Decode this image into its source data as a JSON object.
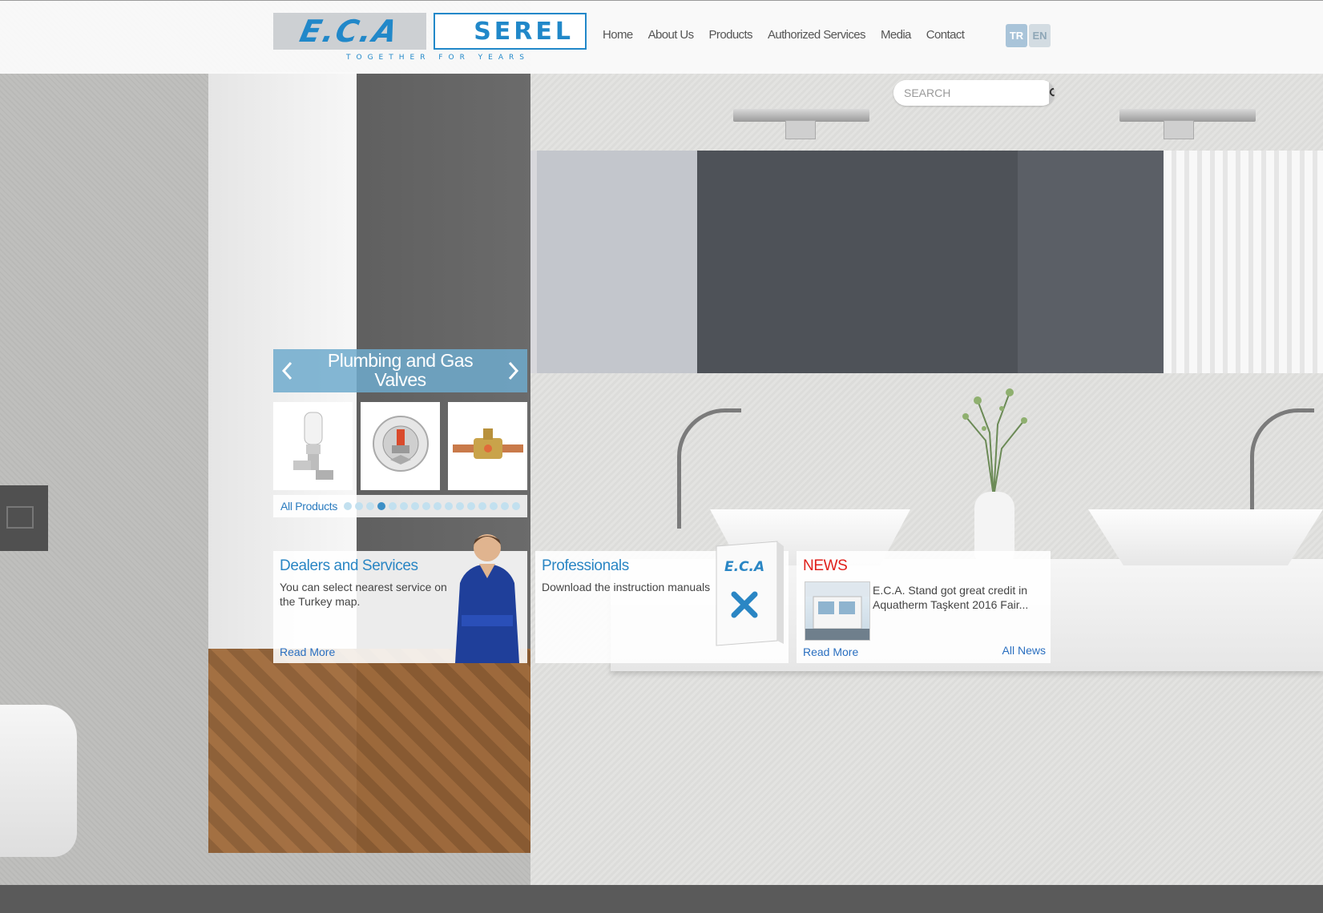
{
  "header": {
    "logo_eca": "E.C.A",
    "logo_serel": "SEREL",
    "tagline": "TOGETHER FOR YEARS",
    "nav": [
      "Home",
      "About Us",
      "Products",
      "Authorized Services",
      "Media",
      "Contact"
    ],
    "lang_tr": "TR",
    "lang_en": "EN",
    "colors": {
      "brand": "#2188c9",
      "lang_active": "#a9c4d9",
      "lang_inactive": "#d3dce2"
    }
  },
  "search": {
    "placeholder": "SEARCH",
    "icon": "search-icon"
  },
  "slider": {
    "title": "Plumbing and Gas Valves",
    "prev_icon": "chevron-left-icon",
    "next_icon": "chevron-right-icon",
    "items": [
      "radiator-valve",
      "sprinkler-head",
      "brass-ball-valve"
    ],
    "all_products": "All Products",
    "dot_count": 16,
    "active_dot": 3,
    "color": "#6eaacd"
  },
  "dealers": {
    "title": "Dealers and Services",
    "text": "You can select nearest service on the Turkey map.",
    "read_more": "Read More"
  },
  "professionals": {
    "title": "Professionals",
    "text": "Download the instruction manuals",
    "book_logo": "E.C.A"
  },
  "news": {
    "title": "NEWS",
    "text": "E.C.A. Stand got great credit in Aquatherm Taşkent 2016 Fair...",
    "read_more": "Read More",
    "all_news": "All News",
    "title_color": "#e0201b"
  }
}
